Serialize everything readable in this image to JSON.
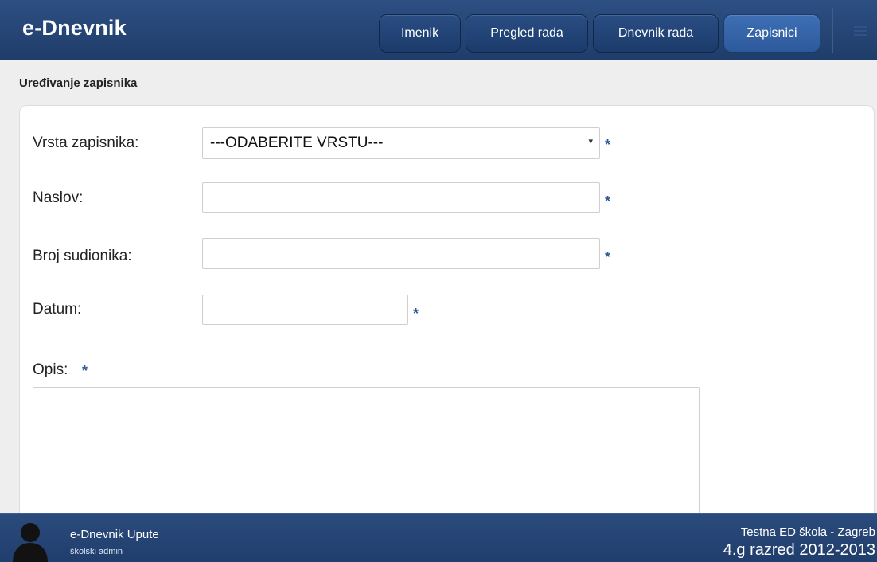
{
  "header": {
    "brand": "e-Dnevnik",
    "nav": [
      {
        "label": "Imenik"
      },
      {
        "label": "Pregled rada"
      },
      {
        "label": "Dnevnik rada"
      },
      {
        "label": "Zapisnici"
      }
    ],
    "menu_icon": "hamburger-icon"
  },
  "subbar": {
    "title": "Uređivanje zapisnika"
  },
  "form": {
    "vrsta_label": "Vrsta zapisnika:",
    "vrsta_value": "---ODABERITE VRSTU---",
    "naslov_label": "Naslov:",
    "naslov_value": "",
    "broj_label": "Broj sudionika:",
    "broj_value": "",
    "datum_label": "Datum:",
    "datum_value": "",
    "opis_label": "Opis:",
    "opis_value": "",
    "required_mark": "*"
  },
  "footer": {
    "user_name": "e-Dnevnik Upute",
    "user_role": "školski admin",
    "school": "Testna ED škola - Zagreb",
    "class_year": "4.g razred 2012-2013"
  },
  "colors": {
    "header_bg": "#24446f",
    "active_tab": "#3a6aae",
    "required": "#2e5a9c"
  }
}
